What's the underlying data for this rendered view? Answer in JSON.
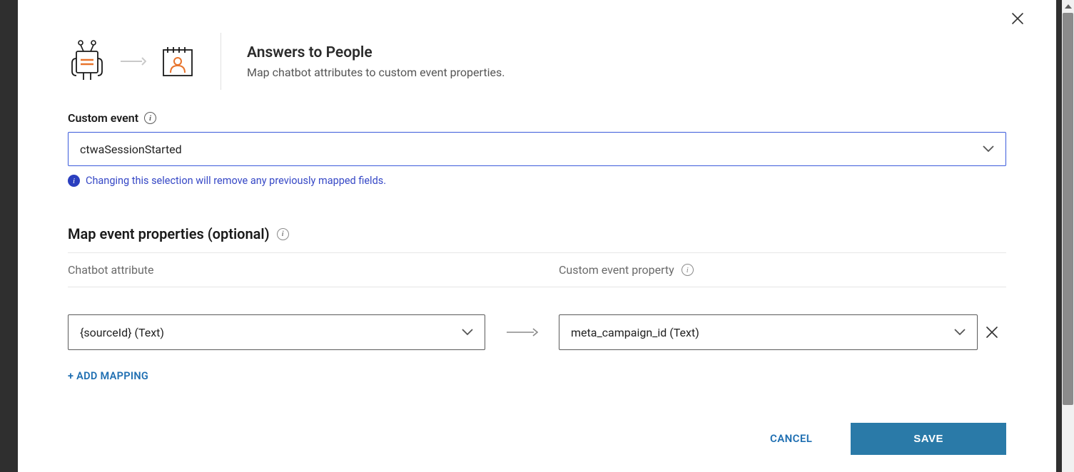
{
  "header": {
    "title": "Answers to People",
    "subtitle": "Map chatbot attributes to custom event properties."
  },
  "customEvent": {
    "label": "Custom event",
    "value": "ctwaSessionStarted",
    "warning": "Changing this selection will remove any previously mapped fields."
  },
  "mapSection": {
    "title": "Map event properties (optional)",
    "leftHeader": "Chatbot attribute",
    "rightHeader": "Custom event property"
  },
  "mappings": [
    {
      "attribute": "{sourceId} (Text)",
      "property": "meta_campaign_id (Text)"
    }
  ],
  "addMappingLabel": "+ ADD MAPPING",
  "footer": {
    "cancel": "CANCEL",
    "save": "SAVE"
  }
}
